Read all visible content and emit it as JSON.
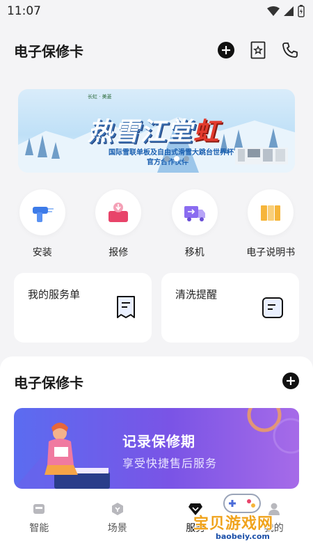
{
  "status": {
    "time": "11:07"
  },
  "header": {
    "title": "电子保修卡"
  },
  "banner": {
    "title_part1": "热雪",
    "title_part2": "江堂",
    "title_part3": "虹",
    "subtitle_line1": "国际雪联单板及自由式滑雪大跳台世界杯",
    "subtitle_line2": "官方合作伙伴",
    "brand_small": "长虹 · 美菱"
  },
  "quick_services": [
    {
      "label": "安装",
      "icon": "install-icon"
    },
    {
      "label": "报修",
      "icon": "repair-icon"
    },
    {
      "label": "移机",
      "icon": "move-icon"
    },
    {
      "label": "电子说明书",
      "icon": "manual-icon"
    }
  ],
  "cards": {
    "orders": {
      "title": "我的服务单",
      "icon": "receipt-icon"
    },
    "cleaning": {
      "title": "清洗提醒",
      "icon": "reminder-icon"
    }
  },
  "panel": {
    "title": "电子保修卡",
    "promo_title": "记录保修期",
    "promo_subtitle": "享受快捷售后服务"
  },
  "nav": [
    {
      "label": "智能",
      "icon": "smart-icon"
    },
    {
      "label": "场景",
      "icon": "scene-icon"
    },
    {
      "label": "服务",
      "icon": "service-icon"
    },
    {
      "label": "我的",
      "icon": "profile-icon"
    }
  ],
  "watermark": {
    "text": "宝贝游戏网",
    "url": "baobeiy.com"
  },
  "colors": {
    "background": "#f4f4f6",
    "promo_start": "#5b6cf0",
    "promo_end": "#a66be8",
    "accent_red": "#e33b2e"
  }
}
